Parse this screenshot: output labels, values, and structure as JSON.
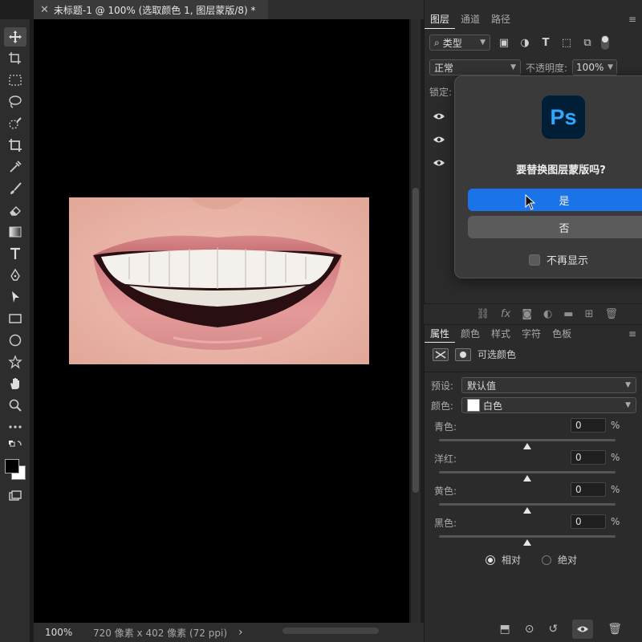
{
  "document": {
    "tab_title": "未标题-1 @ 100% (选取颜色 1, 图层蒙版/8) *",
    "zoom": "100%",
    "info": "720 像素 x 402 像素 (72 ppi)"
  },
  "layers_panel": {
    "tabs": [
      "图层",
      "通道",
      "路径"
    ],
    "filter_label": "类型",
    "blend_mode": "正常",
    "opacity_label": "不透明度:",
    "opacity_value": "100%",
    "lock_label": "锁定:"
  },
  "dialog": {
    "logo_text": "Ps",
    "message": "要替换图层蒙版吗?",
    "yes_label": "是",
    "no_label": "否",
    "checkbox_label": "不再显示",
    "checkbox_checked": false
  },
  "properties_panel": {
    "tabs": [
      "属性",
      "颜色",
      "样式",
      "字符",
      "色板"
    ],
    "adjustment_name": "可选颜色",
    "preset_label": "预设:",
    "preset_value": "默认值",
    "colors_label": "颜色:",
    "colors_value": "白色",
    "sliders": [
      {
        "name": "青色:",
        "value": "0",
        "unit": "%"
      },
      {
        "name": "洋红:",
        "value": "0",
        "unit": "%"
      },
      {
        "name": "黄色:",
        "value": "0",
        "unit": "%"
      },
      {
        "name": "黑色:",
        "value": "0",
        "unit": "%"
      }
    ],
    "method_relative": "相对",
    "method_absolute": "绝对",
    "method_selected": "相对"
  },
  "colors": {
    "accent": "#1a73e8",
    "ps_logo_bg": "#001e36",
    "ps_logo_fg": "#31a8ff",
    "foreground_swatch": "#000000",
    "background_swatch": "#ffffff"
  }
}
